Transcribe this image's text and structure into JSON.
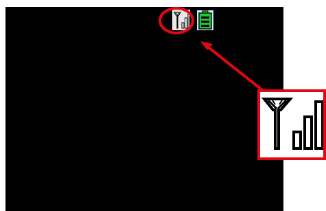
{
  "status_bar": {
    "signal_icon": "signal-strength-icon",
    "battery_icon": "battery-icon",
    "battery_color": "#22c832"
  },
  "annotation": {
    "highlight_color": "#e30613",
    "callout_icon": "signal-strength-icon"
  },
  "screen": {
    "background": "#000000"
  }
}
